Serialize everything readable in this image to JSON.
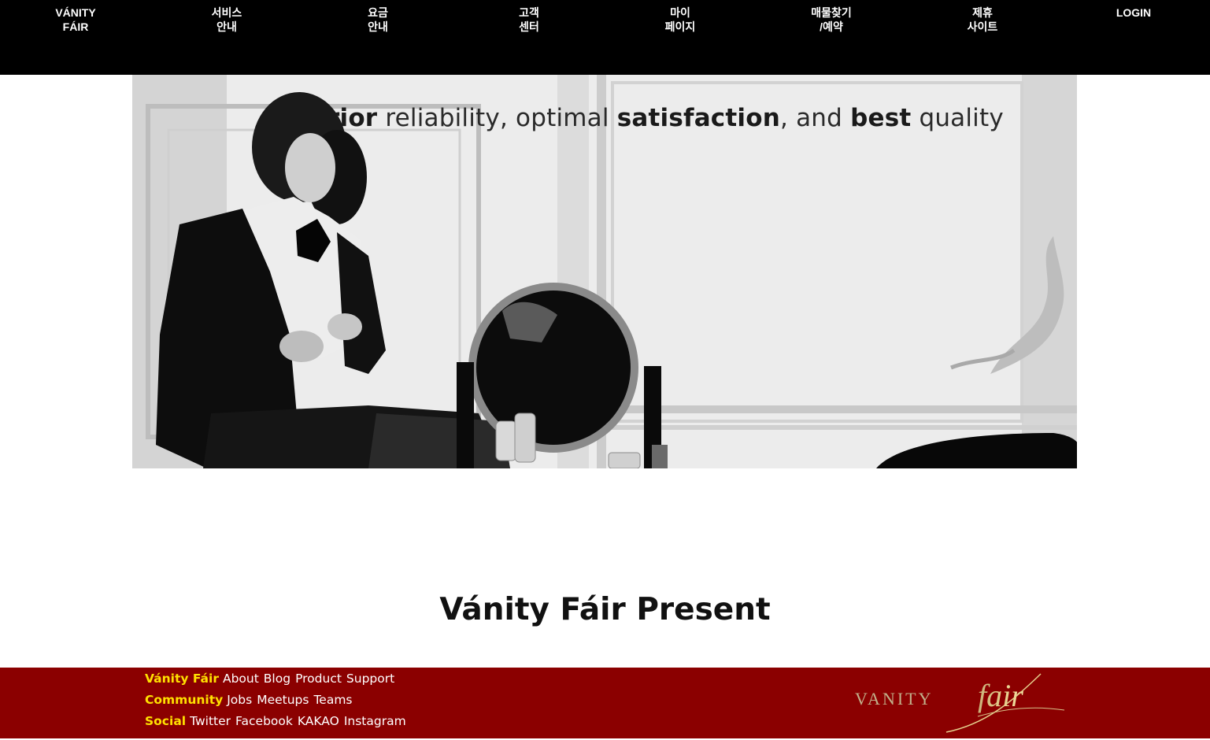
{
  "nav": {
    "brand": {
      "line1": "VÁNITY",
      "line2": "FÁIR"
    },
    "items": [
      {
        "line1": "서비스",
        "line2": "안내"
      },
      {
        "line1": "요금",
        "line2": "안내"
      },
      {
        "line1": "고객",
        "line2": "센터"
      },
      {
        "line1": "마이",
        "line2": "페이지"
      },
      {
        "line1": "매물찾기",
        "line2": "/예약"
      },
      {
        "line1": "제휴",
        "line2": "사이트"
      }
    ],
    "login": "LOGIN"
  },
  "hero": {
    "tagline": {
      "p1": "rior",
      "p2": " reliability, optimal ",
      "p3": "satisfaction",
      "p4": ", and ",
      "p5": "best",
      "p6": " quality"
    }
  },
  "section": {
    "title": "Vánity Fáir Present"
  },
  "footer": {
    "rows": [
      {
        "head": "Vánity Fáir",
        "links": [
          "About",
          "Blog",
          "Product",
          "Support"
        ]
      },
      {
        "head": "Community",
        "links": [
          "Jobs",
          "Meetups",
          "Teams"
        ]
      },
      {
        "head": "Social",
        "links": [
          "Twitter",
          "Facebook",
          "KAKAO",
          "Instagram"
        ]
      }
    ],
    "logo": {
      "word1": "VANITY",
      "word2": "fair"
    }
  },
  "colors": {
    "nav_bg": "#000000",
    "footer_bg": "#8b0000",
    "footer_heading": "#ffe100",
    "text": "#111111"
  }
}
